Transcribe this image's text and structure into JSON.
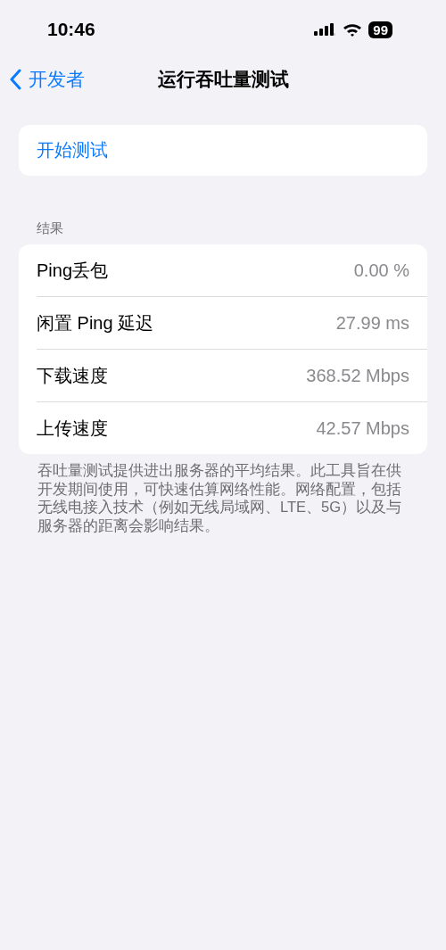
{
  "status_bar": {
    "time": "10:46",
    "battery": "99"
  },
  "nav": {
    "back_label": "开发者",
    "title": "运行吞吐量测试"
  },
  "action": {
    "label": "开始测试"
  },
  "results": {
    "header": "结果",
    "rows": [
      {
        "label": "Ping丢包",
        "value": "0.00 %"
      },
      {
        "label": "闲置 Ping 延迟",
        "value": "27.99 ms"
      },
      {
        "label": "下载速度",
        "value": "368.52 Mbps"
      },
      {
        "label": "上传速度",
        "value": "42.57 Mbps"
      }
    ],
    "footer": "吞吐量测试提供进出服务器的平均结果。此工具旨在供开发期间使用，可快速估算网络性能。网络配置，包括无线电接入技术（例如无线局域网、LTE、5G）以及与服务器的距离会影响结果。"
  }
}
